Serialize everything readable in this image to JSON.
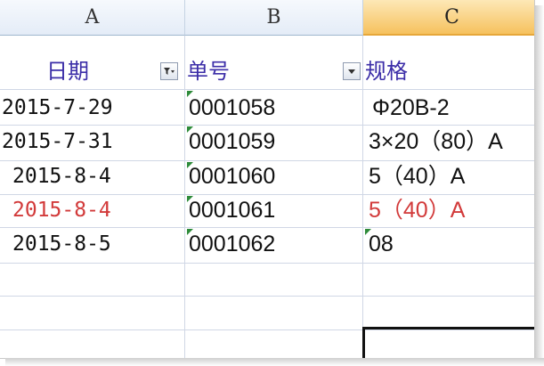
{
  "columns": [
    {
      "letter": "A"
    },
    {
      "letter": "B"
    },
    {
      "letter": "C"
    }
  ],
  "table": {
    "headers": [
      "日期",
      "单号",
      "规格"
    ],
    "rows": [
      {
        "date": "2015-7-29",
        "number": "0001058",
        "spec": "Φ20B-2"
      },
      {
        "date": "2015-7-31",
        "number": "0001059",
        "spec": "3×20（80）A"
      },
      {
        "date": "2015-8-4",
        "number": "0001060",
        "spec": "5（40）A"
      },
      {
        "date": "2015-8-4",
        "number": "0001061",
        "spec": "5（40）A"
      },
      {
        "date": "2015-8-5",
        "number": "0001062",
        "spec": "08"
      }
    ]
  },
  "icons": {
    "filter_active": "filter-funnel-icon",
    "filter_dropdown": "dropdown-arrow-icon"
  },
  "colors": {
    "header_text": "#3c2ea8",
    "highlight_row_text": "#d23a3a",
    "selected_column": "#f6c25e",
    "error_indicator": "#2e8b3a"
  }
}
